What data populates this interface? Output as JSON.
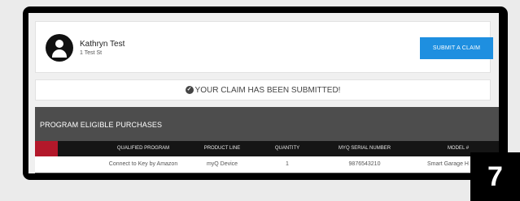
{
  "user": {
    "name": "Kathryn Test",
    "address": "1 Test St"
  },
  "actions": {
    "submit_claim_label": "SUBMIT A CLAIM"
  },
  "notice": {
    "icon": "check-circle-icon",
    "text": "YOUR CLAIM HAS BEEN SUBMITTED!"
  },
  "purchases": {
    "title": "PROGRAM ELIGIBLE PURCHASES",
    "columns": [
      "QUALIFIED PROGRAM",
      "PRODUCT LINE",
      "QUANTITY",
      "MYQ SERIAL NUMBER",
      "MODEL #"
    ],
    "rows": [
      [
        "Connect to Key by Amazon",
        "myQ Device",
        "1",
        "9876543210",
        "Smart Garage H"
      ]
    ]
  },
  "step_badge": "7",
  "colors": {
    "accent_blue": "#1e8fe0",
    "header_red": "#b3182a",
    "panel_gray": "#4d4d4d",
    "table_header": "#151515"
  }
}
